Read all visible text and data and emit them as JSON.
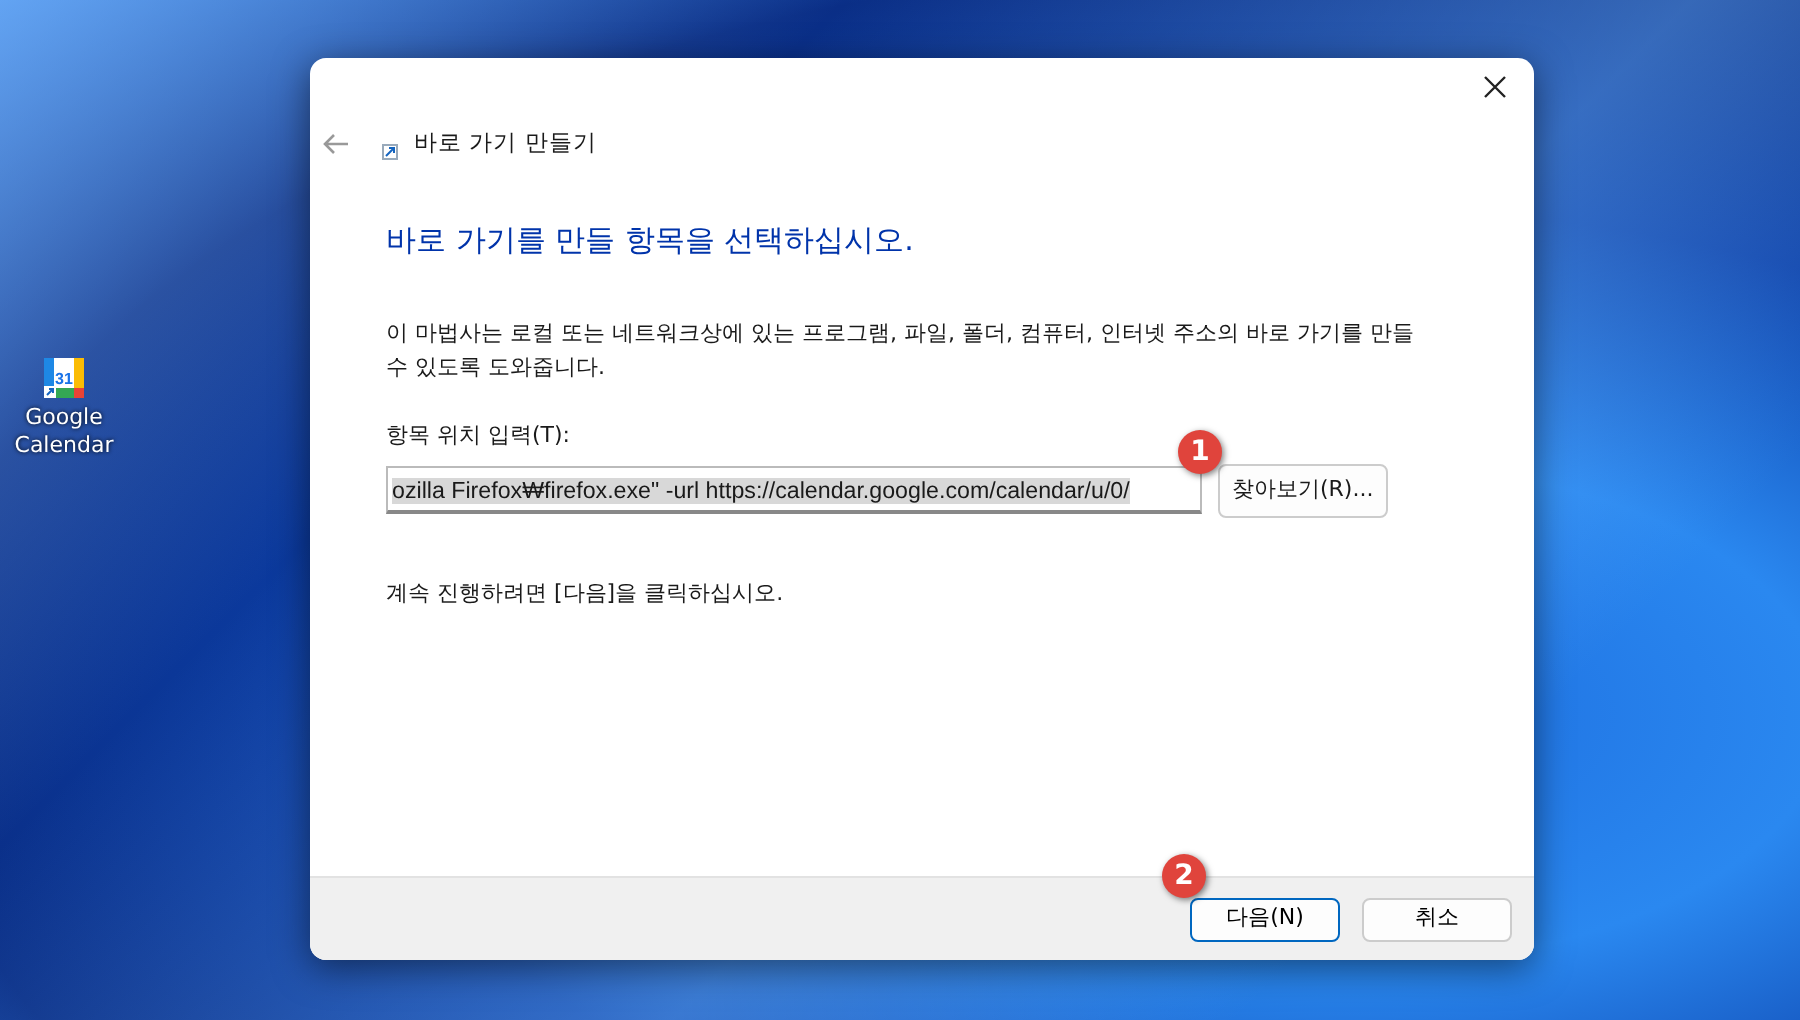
{
  "desktop_icon": {
    "label": "Google Calendar",
    "badge": "31"
  },
  "dialog": {
    "title": "바로 가기 만들기",
    "heading": "바로 가기를 만들 항목을 선택하십시오.",
    "description": "이 마법사는 로컬 또는 네트워크상에 있는 프로그램, 파일, 폴더, 컴퓨터, 인터넷 주소의 바로 가기를 만들 수 있도록 도와줍니다.",
    "field_label": "항목 위치 입력(T):",
    "field_value": "ozilla Firefox₩firefox.exe\" -url https://calendar.google.com/calendar/u/0/",
    "field_selected": true,
    "browse_button": "찾아보기(R)...",
    "hint": "계속 진행하려면 [다음]을 클릭하십시오.",
    "buttons": [
      {
        "label": "다음(N)",
        "selected": true
      },
      {
        "label": "취소",
        "selected": false
      }
    ]
  },
  "callouts": [
    "1",
    "2"
  ]
}
